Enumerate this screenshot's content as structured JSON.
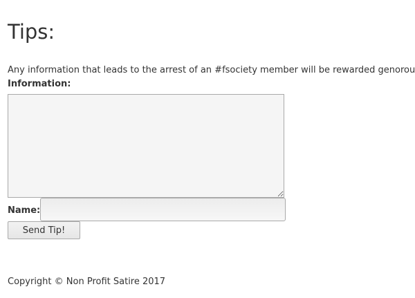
{
  "page": {
    "title": "Tips:",
    "notice": "Any information that leads to the arrest of an #fsociety member will be rewarded genorously."
  },
  "form": {
    "information_label": "Information:",
    "information_value": "",
    "name_label": "Name:",
    "name_value": "",
    "submit_label": "Send Tip!"
  },
  "footer": {
    "copyright": "Copyright © Non Profit Satire 2017"
  }
}
